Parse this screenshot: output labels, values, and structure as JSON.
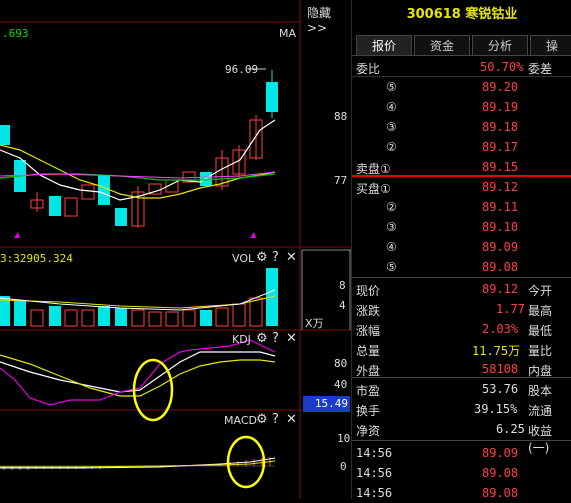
{
  "chart": {
    "top_value": ".693",
    "ma_label": "MA",
    "hide_label": "隐藏>>",
    "price_high_annot": "96.09",
    "y_ticks": [
      "88",
      "77"
    ],
    "vol_label": "VOL",
    "vol_value": "3:32905.324",
    "vol_ticks": [
      "8",
      "4"
    ],
    "vol_unit": "X万",
    "kdj_label": "KDJ",
    "kdj_ticks": [
      "80",
      "40"
    ],
    "kdj_badge": "15.49",
    "macd_label": "MACD",
    "macd_ticks": [
      "10",
      "0"
    ],
    "panel_icons": [
      "gear-icon",
      "help-icon",
      "close-icon"
    ]
  },
  "stock": {
    "code": "300618",
    "name": "寒锐钴业"
  },
  "tabs": [
    {
      "label": "报价",
      "active": true
    },
    {
      "label": "资金",
      "active": false
    },
    {
      "label": "分析",
      "active": false
    },
    {
      "label": "操",
      "active": false
    }
  ],
  "order_book": {
    "ratio_label": "委比",
    "ratio_value": "50.70%",
    "diff_label": "委差",
    "sell": [
      {
        "label": "⑤",
        "price": "89.20"
      },
      {
        "label": "④",
        "price": "89.19"
      },
      {
        "label": "③",
        "price": "89.18"
      },
      {
        "label": "②",
        "price": "89.17"
      },
      {
        "label": "卖盘①",
        "price": "89.15"
      }
    ],
    "buy": [
      {
        "label": "买盘①",
        "price": "89.12"
      },
      {
        "label": "②",
        "price": "89.11"
      },
      {
        "label": "③",
        "price": "89.10"
      },
      {
        "label": "④",
        "price": "89.09"
      },
      {
        "label": "⑤",
        "price": "89.08"
      }
    ]
  },
  "quote": [
    {
      "l": "现价",
      "v": "89.12",
      "r": "今开",
      "color": "red"
    },
    {
      "l": "涨跌",
      "v": "1.77",
      "r": "最高",
      "color": "red"
    },
    {
      "l": "涨幅",
      "v": "2.03%",
      "r": "最低",
      "color": "red"
    },
    {
      "l": "总量",
      "v": "11.75万",
      "r": "量比",
      "color": "yellow"
    },
    {
      "l": "外盘",
      "v": "58108",
      "r": "内盘",
      "color": "red"
    }
  ],
  "fundamentals": [
    {
      "l": "市盈",
      "v": "53.76",
      "r": "股本"
    },
    {
      "l": "换手",
      "v": "39.15%",
      "r": "流通"
    },
    {
      "l": "净资",
      "v": "6.25",
      "r": "收益(一)"
    }
  ],
  "ticks": [
    {
      "time": "14:56",
      "price": "89.09"
    },
    {
      "time": "14:56",
      "price": "89.08"
    },
    {
      "time": "14:56",
      "price": "89.08"
    }
  ],
  "colors": {
    "up": "#ff4040",
    "down": "#00e5e5",
    "ma5": "#ffffff",
    "ma10": "#e6e600",
    "ma20": "#00c000",
    "kdj_k": "#ffffff",
    "kdj_d": "#e6e600",
    "kdj_j": "#e000e0"
  }
}
